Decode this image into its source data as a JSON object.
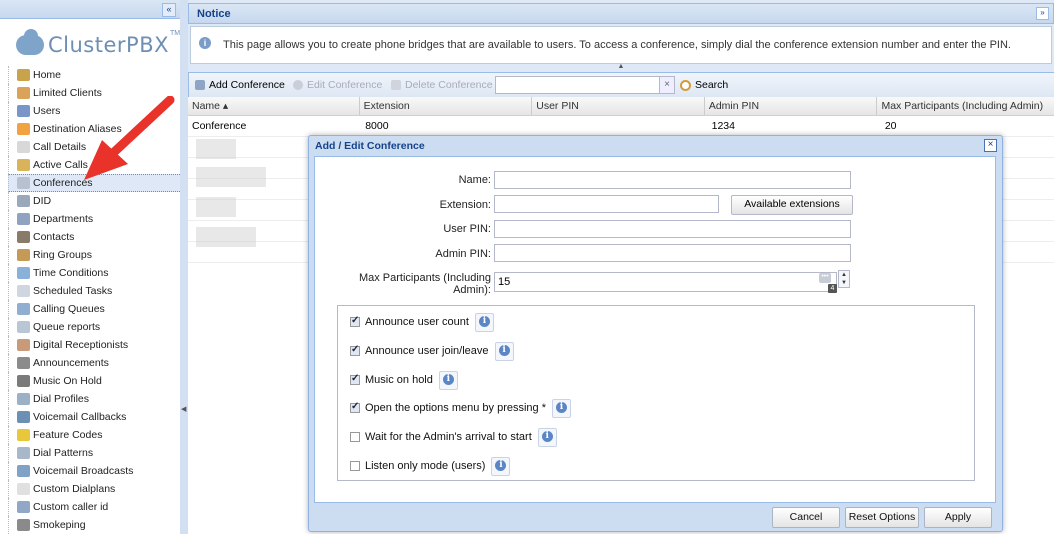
{
  "sidebar": {
    "collapse_label": "«",
    "logo_text": "ClusterPBX",
    "logo_tm": "TM",
    "items": [
      {
        "label": "Home",
        "icon": "home-icon",
        "color": "#c9a24c"
      },
      {
        "label": "Limited Clients",
        "icon": "user-icon",
        "color": "#d9a35a"
      },
      {
        "label": "Users",
        "icon": "users-icon",
        "color": "#7a95c8"
      },
      {
        "label": "Destination Aliases",
        "icon": "star-icon",
        "color": "#f0a340"
      },
      {
        "label": "Call Details",
        "icon": "document-icon",
        "color": "#d8d8d8"
      },
      {
        "label": "Active Calls",
        "icon": "phone-icon",
        "color": "#d8b35a"
      },
      {
        "label": "Conferences",
        "icon": "conference-icon",
        "color": "#b7c2cf"
      },
      {
        "label": "DID",
        "icon": "grid-icon",
        "color": "#9aa8bb"
      },
      {
        "label": "Departments",
        "icon": "building-icon",
        "color": "#8fa3c1"
      },
      {
        "label": "Contacts",
        "icon": "contacts-icon",
        "color": "#8a7a6a"
      },
      {
        "label": "Ring Groups",
        "icon": "ring-group-icon",
        "color": "#c59a56"
      },
      {
        "label": "Time Conditions",
        "icon": "clock-icon",
        "color": "#8ab1d9"
      },
      {
        "label": "Scheduled Tasks",
        "icon": "calendar-icon",
        "color": "#d0d6df"
      },
      {
        "label": "Calling Queues",
        "icon": "queue-icon",
        "color": "#90aed0"
      },
      {
        "label": "Queue reports",
        "icon": "table-icon",
        "color": "#b8c6d6"
      },
      {
        "label": "Digital Receptionists",
        "icon": "receptionist-icon",
        "color": "#c89a7a"
      },
      {
        "label": "Announcements",
        "icon": "speaker-icon",
        "color": "#8b8b8b"
      },
      {
        "label": "Music On Hold",
        "icon": "music-icon",
        "color": "#7a7a7a"
      },
      {
        "label": "Dial Profiles",
        "icon": "dial-profile-icon",
        "color": "#9cb0c8"
      },
      {
        "label": "Voicemail Callbacks",
        "icon": "voicemail-icon",
        "color": "#6c8fb4"
      },
      {
        "label": "Feature Codes",
        "icon": "feature-star-icon",
        "color": "#e8c83a"
      },
      {
        "label": "Dial Patterns",
        "icon": "dial-pattern-icon",
        "color": "#a8b7ca"
      },
      {
        "label": "Voicemail Broadcasts",
        "icon": "broadcast-icon",
        "color": "#7fa2c6"
      },
      {
        "label": "Custom Dialplans",
        "icon": "dialplan-icon",
        "color": "#e0e0e0"
      },
      {
        "label": "Custom caller id",
        "icon": "caller-id-icon",
        "color": "#90a8c6"
      },
      {
        "label": "Smokeping",
        "icon": "smokeping-icon",
        "color": "#8a8a8a"
      }
    ]
  },
  "notice": {
    "title": "Notice",
    "collapse_label": "»",
    "text": "This page allows you to create phone bridges that are available to users. To access a conference, simply dial the conference extension number and enter the PIN."
  },
  "toolbar": {
    "add_label": "Add Conference",
    "edit_label": "Edit Conference",
    "delete_label": "Delete Conference",
    "search_value": "",
    "clear_label": "×",
    "search_label": "Search"
  },
  "grid": {
    "columns": [
      "Name ▴",
      "Extension",
      "User PIN",
      "Admin PIN",
      "Max Participants (Including Admin)"
    ],
    "rows": [
      [
        "Conference",
        "8000",
        "",
        "1234",
        "20"
      ]
    ]
  },
  "dialog": {
    "title": "Add / Edit Conference",
    "close_label": "×",
    "fields": {
      "name_label": "Name:",
      "name_value": "",
      "extension_label": "Extension:",
      "extension_value": "",
      "available_ext_label": "Available extensions",
      "user_pin_label": "User PIN:",
      "user_pin_value": "",
      "admin_pin_label": "Admin PIN:",
      "admin_pin_value": "",
      "max_label_1": "Max Participants (Including",
      "max_label_2": "Admin):",
      "max_value": "15"
    },
    "options": [
      {
        "label": "Announce user count",
        "checked": true
      },
      {
        "label": "Announce user join/leave",
        "checked": true
      },
      {
        "label": "Music on hold",
        "checked": true
      },
      {
        "label": "Open the options menu by pressing *",
        "checked": true
      },
      {
        "label": "Wait for the Admin's arrival to start",
        "checked": false
      },
      {
        "label": "Listen only mode (users)",
        "checked": false
      }
    ],
    "buttons": {
      "cancel": "Cancel",
      "reset": "Reset Options",
      "apply": "Apply"
    }
  },
  "colors": {
    "accent": "#15428b",
    "arrow": "#e8322a",
    "header_bg": "#c7d8ee"
  }
}
